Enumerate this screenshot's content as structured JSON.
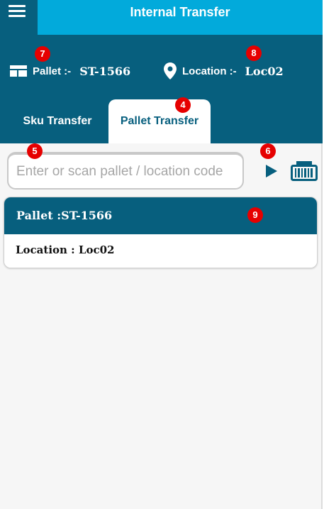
{
  "app": {
    "title": "Internal Transfer"
  },
  "info": {
    "pallet_label": "Pallet :-",
    "pallet_value": "ST-1566",
    "location_label": "Location :-",
    "location_value": "Loc02"
  },
  "tabs": [
    {
      "label": "Sku Transfer",
      "active": false
    },
    {
      "label": "Pallet Transfer",
      "active": true
    }
  ],
  "search": {
    "placeholder": "Enter or scan pallet / location code",
    "value": ""
  },
  "card": {
    "header": "Pallet :ST-1566",
    "location": "Location : Loc02"
  },
  "badges": {
    "b4": "4",
    "b5": "5",
    "b6": "6",
    "b7": "7",
    "b8": "8",
    "b9": "9"
  },
  "colors": {
    "primary": "#075f7e",
    "accent": "#02aadb",
    "badge": "#e60000",
    "background": "#f6f6f6"
  },
  "icons": {
    "menu": "hamburger-icon",
    "pallet": "pallet-icon",
    "location": "location-pin-icon",
    "play": "play-icon",
    "barcode": "barcode-scanner-icon"
  }
}
